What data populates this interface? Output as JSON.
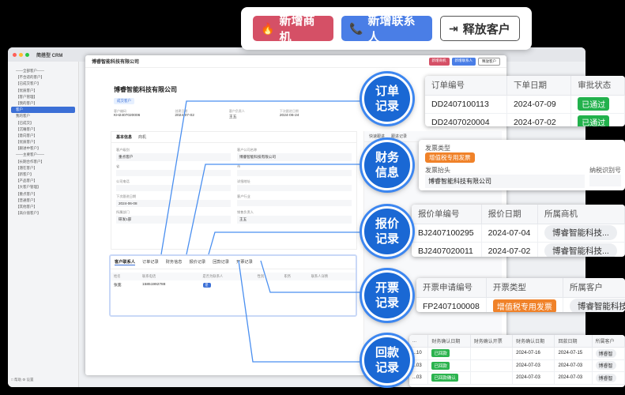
{
  "actions": {
    "new_opportunity": "新增商机",
    "new_contact": "新增联系人",
    "release_customer": "释放客户"
  },
  "app": {
    "title": "简搭型 CRM",
    "sidebar": [
      "——全部客户——",
      "【不合适的客户】",
      "【已成交客户】",
      "【优质客户】",
      "【客户管理】",
      "【我的客户】",
      "客户",
      "我的客户",
      "【已成交】",
      "【沉睡客户】",
      "【意向客户】",
      "【优质客户】",
      "【跟进中客户】",
      "——主要客户——",
      "【长期合作客户】",
      "【潜在客户】",
      "【新客户】",
      "【产品客户】",
      "【大客户管理】",
      "【重点客户】",
      "【普通客户】",
      "【其他客户】",
      "【高价值客户】"
    ],
    "sidebar_active_index": 6,
    "footer": "□ 帮助    ⚙ 设置"
  },
  "panel": {
    "title": "博睿智能科技有限公司",
    "btn_opportunity": "新增商机",
    "btn_contact": "新增联系人",
    "btn_release": "释放客户",
    "company_name": "博睿智能科技有限公司",
    "stage_tag": "成交客户",
    "summary": [
      {
        "k": "客户编码",
        "v": "KH2407020006"
      },
      {
        "k": "创建日期",
        "v": "2024-07-02"
      },
      {
        "k": "客户负责人",
        "v": "王五"
      },
      {
        "k": "下次跟进日期",
        "v": "2024-06-24"
      }
    ],
    "info_tabs": [
      "基本信息",
      "商机"
    ],
    "fields": [
      {
        "k": "客户级别",
        "v": "重点客户"
      },
      {
        "k": "客户公司名称",
        "v": "博睿智能科技有限公司"
      },
      {
        "k": "省",
        "v": ""
      },
      {
        "k": "市",
        "v": ""
      },
      {
        "k": "公司电话",
        "v": ""
      },
      {
        "k": "详细地址",
        "v": ""
      },
      {
        "k": "下次跟进日期",
        "v": "2024-06-08"
      },
      {
        "k": "客户行业",
        "v": ""
      },
      {
        "k": "所属部门",
        "v": "研发1部"
      },
      {
        "k": "销售负责人",
        "v": "王五"
      }
    ],
    "right_tabs": [
      "快速跟进",
      "跟进记录"
    ]
  },
  "contacts": {
    "tabs": [
      "客户联系人",
      "订单记录",
      "财务信息",
      "报价记录",
      "回款记录",
      "开票记录"
    ],
    "headers": [
      "姓名",
      "联系电话",
      "是否为联系人",
      "性别",
      "职务",
      "联系人详情"
    ],
    "rows": [
      {
        "name": "张宽",
        "phone": "15851992788",
        "is_contact": "是",
        "gender": "",
        "title": "",
        "detail": ""
      }
    ]
  },
  "badges": {
    "orders": "订单记录",
    "finance": "财务信息",
    "quotes": "报价记录",
    "invoices": "开票记录",
    "payments": "回款记录"
  },
  "orders": {
    "headers": [
      "订单编号",
      "下单日期",
      "审批状态"
    ],
    "rows": [
      {
        "no": "DD2407100113",
        "date": "2024-07-09",
        "status": "已通过"
      },
      {
        "no": "DD2407020004",
        "date": "2024-07-02",
        "status": "已通过"
      }
    ]
  },
  "finance": {
    "invoice_type_label": "发票类型",
    "invoice_type": "增值税专用发票",
    "invoice_title_label": "发票抬头",
    "invoice_title": "博睿智能科技有限公司",
    "tax_id_label": "纳税识别号",
    "tax_id": ""
  },
  "quotes": {
    "headers": [
      "报价单编号",
      "报价日期",
      "所属商机"
    ],
    "rows": [
      {
        "no": "BJ2407100295",
        "date": "2024-07-04",
        "opp": "博睿智能科技..."
      },
      {
        "no": "BJ2407020011",
        "date": "2024-07-02",
        "opp": "博睿智能科技..."
      }
    ]
  },
  "invoices": {
    "headers": [
      "开票申请编号",
      "开票类型",
      "所属客户",
      "所属"
    ],
    "rows": [
      {
        "no": "FP2407100008",
        "type": "增值税专用发票",
        "customer": "博睿智能科技..."
      }
    ]
  },
  "payments": {
    "headers": [
      "...",
      "财务确认日期",
      "财务确认开票",
      "财务确认日期",
      "回款日期",
      "所属客户"
    ],
    "rows": [
      {
        "id": "...10",
        "status": "已回款",
        "confirm_invoice": "",
        "confirm_date": "2024-07-16",
        "pay_date": "2024-07-15",
        "customer": "博睿智"
      },
      {
        "id": "...03",
        "status": "已回款",
        "confirm_invoice": "",
        "confirm_date": "2024-07-03",
        "pay_date": "2024-07-03",
        "customer": "博睿智"
      },
      {
        "id": "...03",
        "status": "已回款确认",
        "confirm_invoice": "",
        "confirm_date": "2024-07-03",
        "pay_date": "2024-07-03",
        "customer": "博睿智"
      }
    ]
  },
  "colors": {
    "red": "#d55066",
    "blue": "#4a7ee6",
    "badge_blue": "#1a68d4",
    "approved_green": "#22b14c",
    "invoice_orange": "#f08229"
  }
}
